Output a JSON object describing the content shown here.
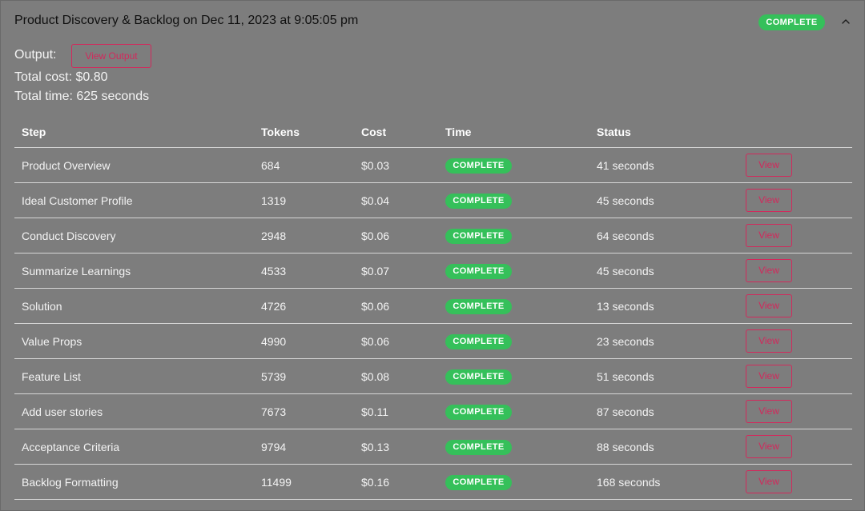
{
  "run": {
    "title": "Product Discovery & Backlog on Dec 11, 2023 at 9:05:05 pm",
    "status": "COMPLETE",
    "output_label": "Output:",
    "view_output_label": "View Output",
    "total_cost": "Total cost: $0.80",
    "total_time": "Total time: 625 seconds"
  },
  "colors": {
    "badge_green": "#35c05a",
    "button_pink": "#d2295c",
    "panel_gray": "#7d7d7d"
  },
  "table": {
    "headers": [
      "Step",
      "Tokens",
      "Cost",
      "Time",
      "Status"
    ],
    "view_label": "View",
    "rows": [
      {
        "step": "Product Overview",
        "tokens": "684",
        "cost": "$0.03",
        "badge": "COMPLETE",
        "duration": "41 seconds"
      },
      {
        "step": "Ideal Customer Profile",
        "tokens": "1319",
        "cost": "$0.04",
        "badge": "COMPLETE",
        "duration": "45 seconds"
      },
      {
        "step": "Conduct Discovery",
        "tokens": "2948",
        "cost": "$0.06",
        "badge": "COMPLETE",
        "duration": "64 seconds"
      },
      {
        "step": "Summarize Learnings",
        "tokens": "4533",
        "cost": "$0.07",
        "badge": "COMPLETE",
        "duration": "45 seconds"
      },
      {
        "step": "Solution",
        "tokens": "4726",
        "cost": "$0.06",
        "badge": "COMPLETE",
        "duration": "13 seconds"
      },
      {
        "step": "Value Props",
        "tokens": "4990",
        "cost": "$0.06",
        "badge": "COMPLETE",
        "duration": "23 seconds"
      },
      {
        "step": "Feature List",
        "tokens": "5739",
        "cost": "$0.08",
        "badge": "COMPLETE",
        "duration": "51 seconds"
      },
      {
        "step": "Add user stories",
        "tokens": "7673",
        "cost": "$0.11",
        "badge": "COMPLETE",
        "duration": "87 seconds"
      },
      {
        "step": "Acceptance Criteria",
        "tokens": "9794",
        "cost": "$0.13",
        "badge": "COMPLETE",
        "duration": "88 seconds"
      },
      {
        "step": "Backlog Formatting",
        "tokens": "11499",
        "cost": "$0.16",
        "badge": "COMPLETE",
        "duration": "168 seconds"
      }
    ]
  }
}
